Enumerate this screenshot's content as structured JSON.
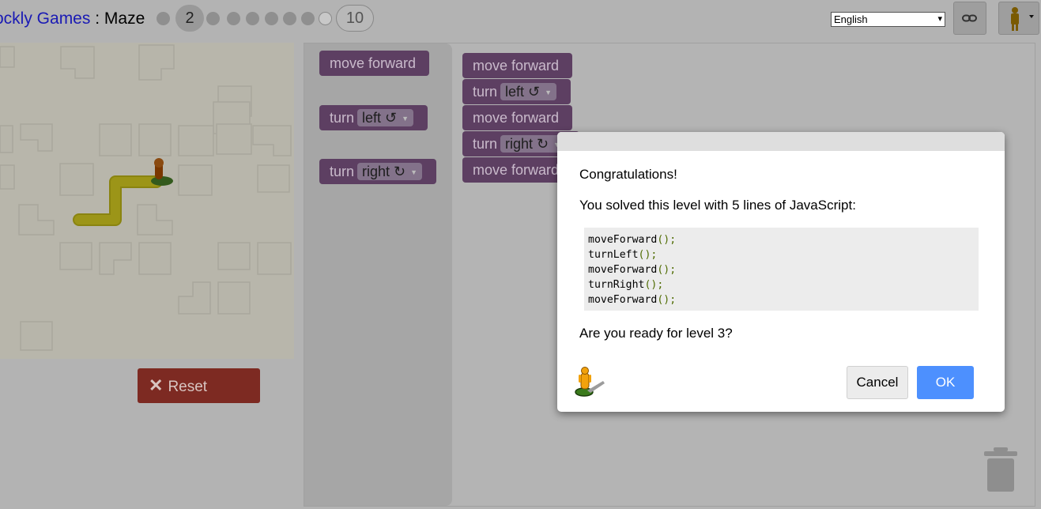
{
  "header": {
    "title_link": "ockly Games",
    "title_separator": " : ",
    "title_page": "Maze",
    "current_level": "2",
    "last_level": "10",
    "language": "English"
  },
  "icons": {
    "link": "link-icon",
    "pegman": "pegman-icon",
    "trash": "trash-icon",
    "reset_x": "close-icon"
  },
  "reset_label": "Reset",
  "toolbox": [
    {
      "kind": "move",
      "label": "move forward"
    },
    {
      "kind": "turn",
      "label": "turn",
      "dir": "left ↺"
    },
    {
      "kind": "turn",
      "label": "turn",
      "dir": "right ↻"
    }
  ],
  "program": [
    {
      "label": "move forward"
    },
    {
      "label": "turn",
      "dir": "left ↺"
    },
    {
      "label": "move forward"
    },
    {
      "label": "turn",
      "dir": "right ↻"
    },
    {
      "label": "move forward"
    }
  ],
  "dialog": {
    "congrats": "Congratulations!",
    "solved": "You solved this level with 5 lines of JavaScript:",
    "code": [
      {
        "name": "moveForward",
        "tail": "();"
      },
      {
        "name": "turnLeft",
        "tail": "();"
      },
      {
        "name": "moveForward",
        "tail": "();"
      },
      {
        "name": "turnRight",
        "tail": "();"
      },
      {
        "name": "moveForward",
        "tail": "();"
      }
    ],
    "question": "Are you ready for level 3?",
    "cancel": "Cancel",
    "ok": "OK"
  },
  "colors": {
    "link": "#1a1ab4",
    "ok_button": "#4d90fe",
    "block": "#5d3f62",
    "reset": "#7d2a22"
  }
}
